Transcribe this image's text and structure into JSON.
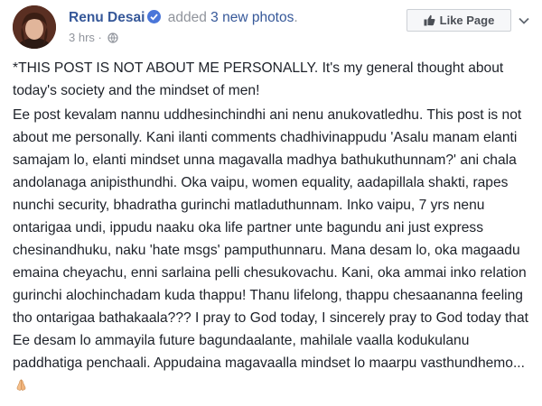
{
  "post": {
    "author": "Renu Desai",
    "action_prefix": "added",
    "action_link": "3 new photos",
    "action_suffix": ".",
    "time": "3 hrs",
    "separator": "·",
    "like_page_label": "Like Page",
    "paragraph1": "*THIS POST IS NOT ABOUT ME PERSONALLY. It's my general thought about today's society and the mindset of men!",
    "paragraph2": "Ee post kevalam nannu uddhesinchindhi ani nenu anukovatledhu. This post is not about me personally. Kani ilanti comments chadhivinappudu 'Asalu manam elanti samajam lo, elanti mindset unna magavalla madhya bathukuthunnam?' ani chala andolanaga anipisthundhi. Oka vaipu, women equality, aadapillala shakti, rapes nunchi security, bhadratha gurinchi matladuthunnam. Inko vaipu, 7 yrs nenu ontarigaa undi, ippudu naaku oka life partner unte bagundu ani just express chesinandhuku, naku 'hate msgs' pamputhunnaru. Mana desam lo, oka magaadu emaina cheyachu, enni sarlaina pelli chesukovachu. Kani, oka ammai inko relation gurinchi alochinchadam kuda thappu! Thanu lifelong, thappu chesaananna feeling tho ontarigaa bathakaala??? I pray to God today, I sincerely pray to God today that Ee desam lo ammayila future bagundaalante, mahilale vaalla kodukulanu paddhatiga penchaali. Appudaina magavaalla mindset lo maarpu vasthundhemo..."
  },
  "icons": {
    "verified": "verified-badge-icon",
    "audience": "globe-icon",
    "like": "thumbs-up-icon",
    "menu": "chevron-down-icon",
    "emoji": "folded-hands-icon"
  },
  "colors": {
    "link": "#365899",
    "meta": "#90949c",
    "text": "#1d2129",
    "verified": "#4a76d9"
  }
}
